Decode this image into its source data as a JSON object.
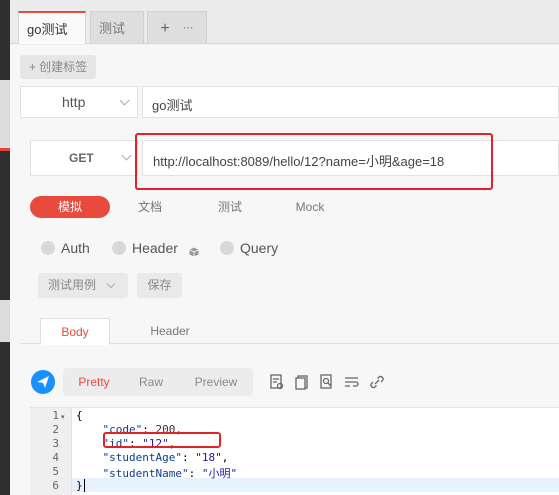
{
  "tabs": [
    {
      "label": "go测试",
      "active": true
    },
    {
      "label": "测试",
      "active": false
    }
  ],
  "tab_add": {
    "plus": "+",
    "more": "···"
  },
  "create_tag_label": "+ 创建标签",
  "protocol": {
    "value": "http",
    "name": "go测试"
  },
  "request": {
    "method": "GET",
    "url": "http://localhost:8089/hello/12?name=小明&age=18"
  },
  "subtabs": [
    "模拟",
    "文档",
    "测试",
    "Mock"
  ],
  "params": [
    "Auth",
    "Header",
    "Query"
  ],
  "actions": {
    "testcase": "测试用例",
    "save": "保存"
  },
  "body_tabs": {
    "body": "Body",
    "header": "Header"
  },
  "formats": [
    "Pretty",
    "Raw",
    "Preview"
  ],
  "code": {
    "line_numbers": [
      "1",
      "2",
      "3",
      "4",
      "5",
      "6"
    ],
    "lines": [
      {
        "text": "{"
      },
      {
        "key": "\"code\"",
        "sep": ": ",
        "val": "200",
        "end": ","
      },
      {
        "key": "\"id\"",
        "sep": ": ",
        "val": "\"12\"",
        "end": ","
      },
      {
        "key": "\"studentAge\"",
        "sep": ": ",
        "val": "\"18\"",
        "end": ","
      },
      {
        "key": "\"studentName\"",
        "sep": ": ",
        "val": "\"小明\"",
        "end": ""
      },
      {
        "text": "}"
      }
    ]
  },
  "colors": {
    "accent": "#e84a3c",
    "highlight_box": "#e0222a",
    "send": "#1890ff"
  }
}
